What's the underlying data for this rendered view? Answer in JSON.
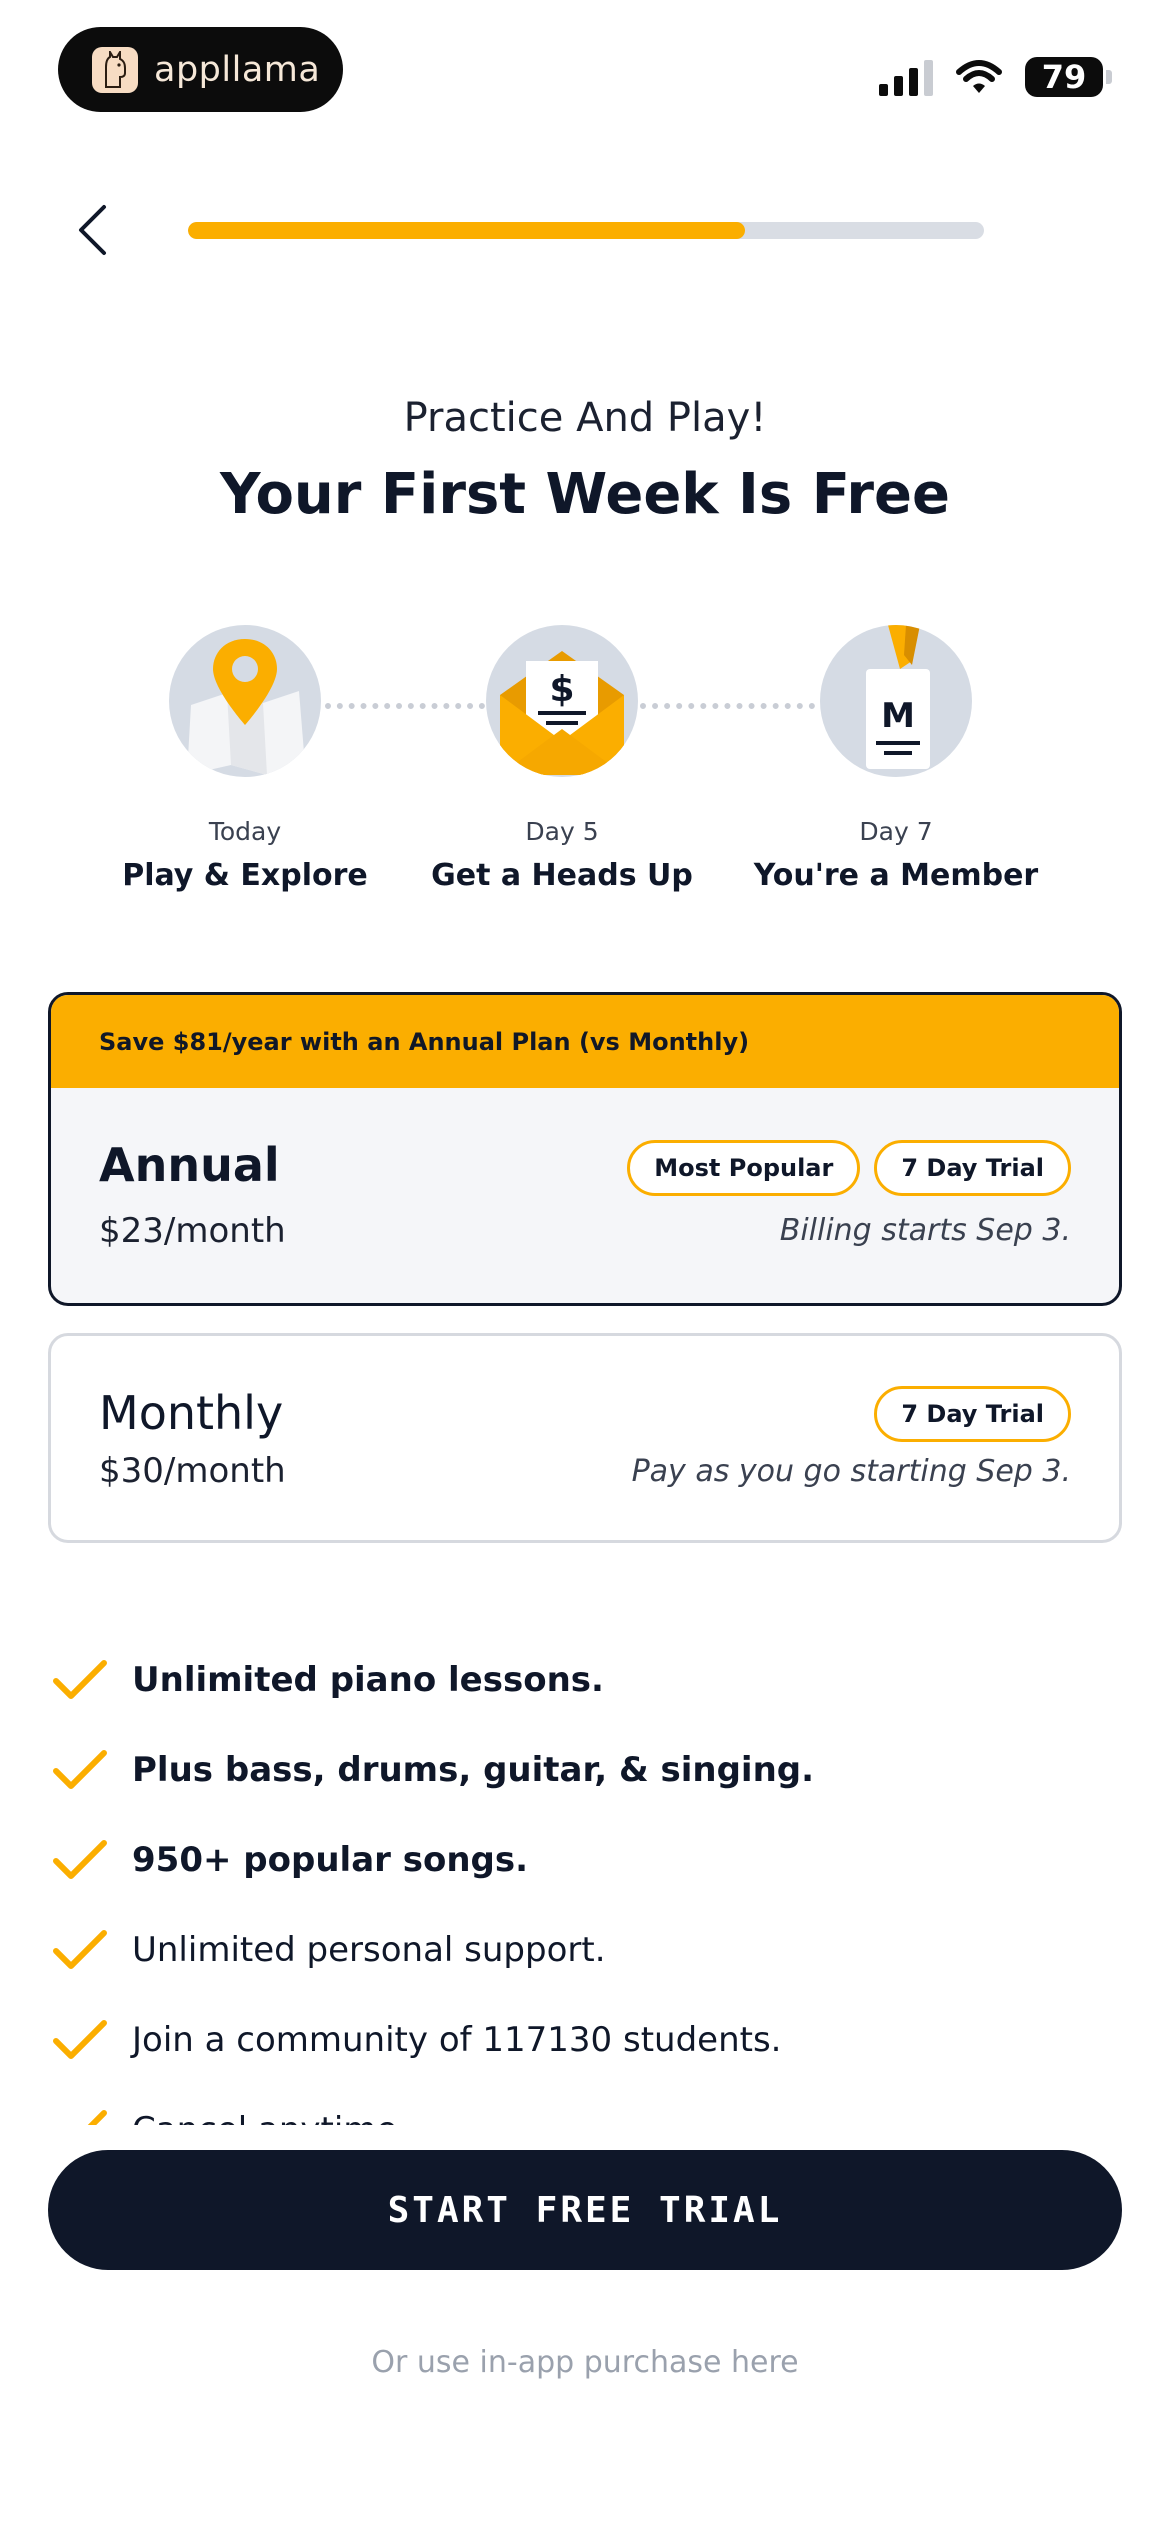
{
  "status_bar": {
    "app_name": "appllama",
    "battery": "79"
  },
  "progress": {
    "fraction": 0.7
  },
  "header": {
    "subtitle": "Practice And Play!",
    "title": "Your First Week Is Free"
  },
  "timeline": [
    {
      "day": "Today",
      "label": "Play & Explore",
      "icon": "map-pin-icon"
    },
    {
      "day": "Day 5",
      "label": "Get a Heads Up",
      "icon": "envelope-dollar-icon"
    },
    {
      "day": "Day 7",
      "label": "You're a Member",
      "icon": "member-badge-icon"
    }
  ],
  "plans": {
    "annual": {
      "banner": "Save $81/year with an Annual Plan (vs Monthly)",
      "name": "Annual",
      "price": "$23/month",
      "badge_popular": "Most Popular",
      "badge_trial": "7 Day Trial",
      "billing": "Billing starts Sep 3."
    },
    "monthly": {
      "name": "Monthly",
      "price": "$30/month",
      "badge_trial": "7 Day Trial",
      "billing": "Pay as you go starting Sep 3."
    }
  },
  "features": [
    {
      "text": "Unlimited piano lessons.",
      "bold": true
    },
    {
      "text": "Plus bass, drums, guitar, & singing.",
      "bold": true
    },
    {
      "text": "950+ popular songs.",
      "bold": true
    },
    {
      "text": "Unlimited personal support.",
      "bold": false
    },
    {
      "text": "Join a community of 117130 students.",
      "bold": false
    },
    {
      "text": "Cancel anytime.",
      "bold": false
    }
  ],
  "cta": {
    "label": "START FREE TRIAL",
    "secondary": "Or use in-app purchase here"
  },
  "colors": {
    "accent": "#fbae00",
    "dark": "#0f1729",
    "muted": "#9aa1ad"
  }
}
